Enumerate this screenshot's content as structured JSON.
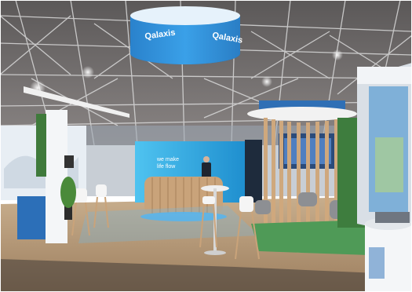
{
  "photo": {
    "signage": {
      "brand_left": "Qalaxis",
      "brand_right": "Qalaxis"
    },
    "screen": {
      "line1": "we make",
      "line2": "life flow"
    }
  },
  "palette": {
    "ceiling": "#6f6c6c",
    "truss": "#d8d8d8",
    "floor": "#b89a77",
    "brand_blue": "#2f8fdc",
    "screen_blue": "#2aa7e0",
    "wood": "#c9a37a",
    "carpet_green": "#4f9a57"
  }
}
